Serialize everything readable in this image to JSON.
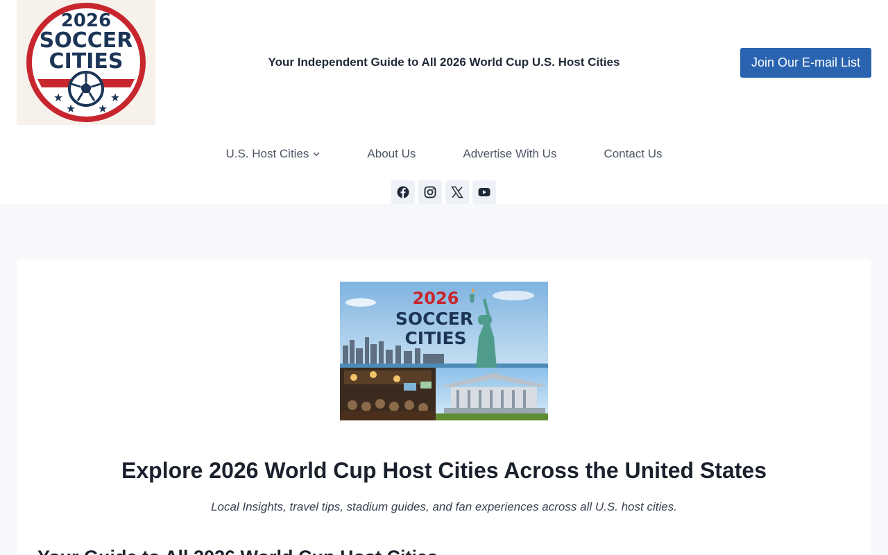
{
  "brand": {
    "logo_year": "2026",
    "logo_line1": "SOCCER",
    "logo_line2": "CITIES"
  },
  "header": {
    "tagline": "Your Independent Guide to All 2026 World Cup U.S. Host Cities",
    "cta_label": "Join Our E-mail List"
  },
  "nav": {
    "items": [
      {
        "label": "U.S. Host Cities",
        "has_dropdown": true
      },
      {
        "label": "About Us"
      },
      {
        "label": "Advertise With Us"
      },
      {
        "label": "Contact Us"
      }
    ]
  },
  "social": [
    "facebook-icon",
    "instagram-icon",
    "x-icon",
    "youtube-icon"
  ],
  "hero_image": {
    "year": "2026",
    "line1": "SOCCER",
    "line2": "CITIES"
  },
  "main": {
    "title": "Explore 2026 World Cup Host Cities Across the United States",
    "subtitle": "Local Insights, travel tips, stadium guides, and fan experiences across all U.S. host cities.",
    "section_heading": "Your Guide to All 2026 World Cup Host Cities"
  },
  "colors": {
    "accent": "#2a64b0",
    "logo_navy": "#1c3557",
    "logo_red": "#c8262e",
    "page_bg": "#f6f8fb"
  }
}
